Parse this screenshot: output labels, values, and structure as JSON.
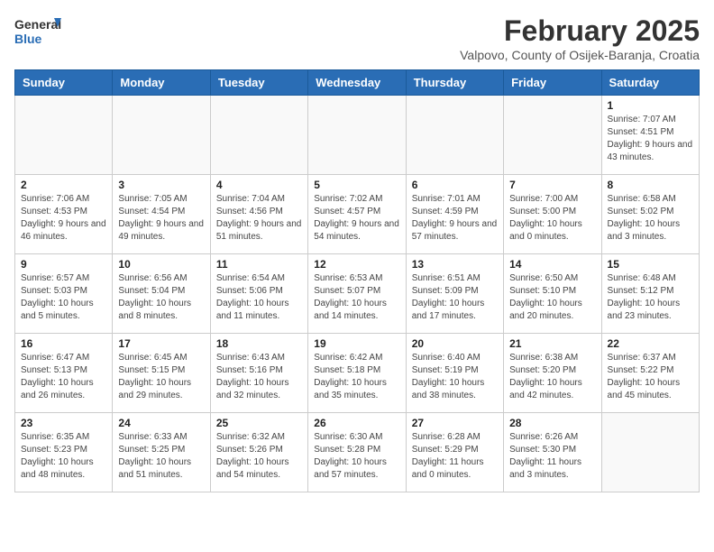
{
  "logo": {
    "general": "General",
    "blue": "Blue"
  },
  "title": {
    "month_year": "February 2025",
    "location": "Valpovo, County of Osijek-Baranja, Croatia"
  },
  "days_of_week": [
    "Sunday",
    "Monday",
    "Tuesday",
    "Wednesday",
    "Thursday",
    "Friday",
    "Saturday"
  ],
  "weeks": [
    [
      {
        "day": "",
        "info": ""
      },
      {
        "day": "",
        "info": ""
      },
      {
        "day": "",
        "info": ""
      },
      {
        "day": "",
        "info": ""
      },
      {
        "day": "",
        "info": ""
      },
      {
        "day": "",
        "info": ""
      },
      {
        "day": "1",
        "info": "Sunrise: 7:07 AM\nSunset: 4:51 PM\nDaylight: 9 hours and 43 minutes."
      }
    ],
    [
      {
        "day": "2",
        "info": "Sunrise: 7:06 AM\nSunset: 4:53 PM\nDaylight: 9 hours and 46 minutes."
      },
      {
        "day": "3",
        "info": "Sunrise: 7:05 AM\nSunset: 4:54 PM\nDaylight: 9 hours and 49 minutes."
      },
      {
        "day": "4",
        "info": "Sunrise: 7:04 AM\nSunset: 4:56 PM\nDaylight: 9 hours and 51 minutes."
      },
      {
        "day": "5",
        "info": "Sunrise: 7:02 AM\nSunset: 4:57 PM\nDaylight: 9 hours and 54 minutes."
      },
      {
        "day": "6",
        "info": "Sunrise: 7:01 AM\nSunset: 4:59 PM\nDaylight: 9 hours and 57 minutes."
      },
      {
        "day": "7",
        "info": "Sunrise: 7:00 AM\nSunset: 5:00 PM\nDaylight: 10 hours and 0 minutes."
      },
      {
        "day": "8",
        "info": "Sunrise: 6:58 AM\nSunset: 5:02 PM\nDaylight: 10 hours and 3 minutes."
      }
    ],
    [
      {
        "day": "9",
        "info": "Sunrise: 6:57 AM\nSunset: 5:03 PM\nDaylight: 10 hours and 5 minutes."
      },
      {
        "day": "10",
        "info": "Sunrise: 6:56 AM\nSunset: 5:04 PM\nDaylight: 10 hours and 8 minutes."
      },
      {
        "day": "11",
        "info": "Sunrise: 6:54 AM\nSunset: 5:06 PM\nDaylight: 10 hours and 11 minutes."
      },
      {
        "day": "12",
        "info": "Sunrise: 6:53 AM\nSunset: 5:07 PM\nDaylight: 10 hours and 14 minutes."
      },
      {
        "day": "13",
        "info": "Sunrise: 6:51 AM\nSunset: 5:09 PM\nDaylight: 10 hours and 17 minutes."
      },
      {
        "day": "14",
        "info": "Sunrise: 6:50 AM\nSunset: 5:10 PM\nDaylight: 10 hours and 20 minutes."
      },
      {
        "day": "15",
        "info": "Sunrise: 6:48 AM\nSunset: 5:12 PM\nDaylight: 10 hours and 23 minutes."
      }
    ],
    [
      {
        "day": "16",
        "info": "Sunrise: 6:47 AM\nSunset: 5:13 PM\nDaylight: 10 hours and 26 minutes."
      },
      {
        "day": "17",
        "info": "Sunrise: 6:45 AM\nSunset: 5:15 PM\nDaylight: 10 hours and 29 minutes."
      },
      {
        "day": "18",
        "info": "Sunrise: 6:43 AM\nSunset: 5:16 PM\nDaylight: 10 hours and 32 minutes."
      },
      {
        "day": "19",
        "info": "Sunrise: 6:42 AM\nSunset: 5:18 PM\nDaylight: 10 hours and 35 minutes."
      },
      {
        "day": "20",
        "info": "Sunrise: 6:40 AM\nSunset: 5:19 PM\nDaylight: 10 hours and 38 minutes."
      },
      {
        "day": "21",
        "info": "Sunrise: 6:38 AM\nSunset: 5:20 PM\nDaylight: 10 hours and 42 minutes."
      },
      {
        "day": "22",
        "info": "Sunrise: 6:37 AM\nSunset: 5:22 PM\nDaylight: 10 hours and 45 minutes."
      }
    ],
    [
      {
        "day": "23",
        "info": "Sunrise: 6:35 AM\nSunset: 5:23 PM\nDaylight: 10 hours and 48 minutes."
      },
      {
        "day": "24",
        "info": "Sunrise: 6:33 AM\nSunset: 5:25 PM\nDaylight: 10 hours and 51 minutes."
      },
      {
        "day": "25",
        "info": "Sunrise: 6:32 AM\nSunset: 5:26 PM\nDaylight: 10 hours and 54 minutes."
      },
      {
        "day": "26",
        "info": "Sunrise: 6:30 AM\nSunset: 5:28 PM\nDaylight: 10 hours and 57 minutes."
      },
      {
        "day": "27",
        "info": "Sunrise: 6:28 AM\nSunset: 5:29 PM\nDaylight: 11 hours and 0 minutes."
      },
      {
        "day": "28",
        "info": "Sunrise: 6:26 AM\nSunset: 5:30 PM\nDaylight: 11 hours and 3 minutes."
      },
      {
        "day": "",
        "info": ""
      }
    ]
  ]
}
